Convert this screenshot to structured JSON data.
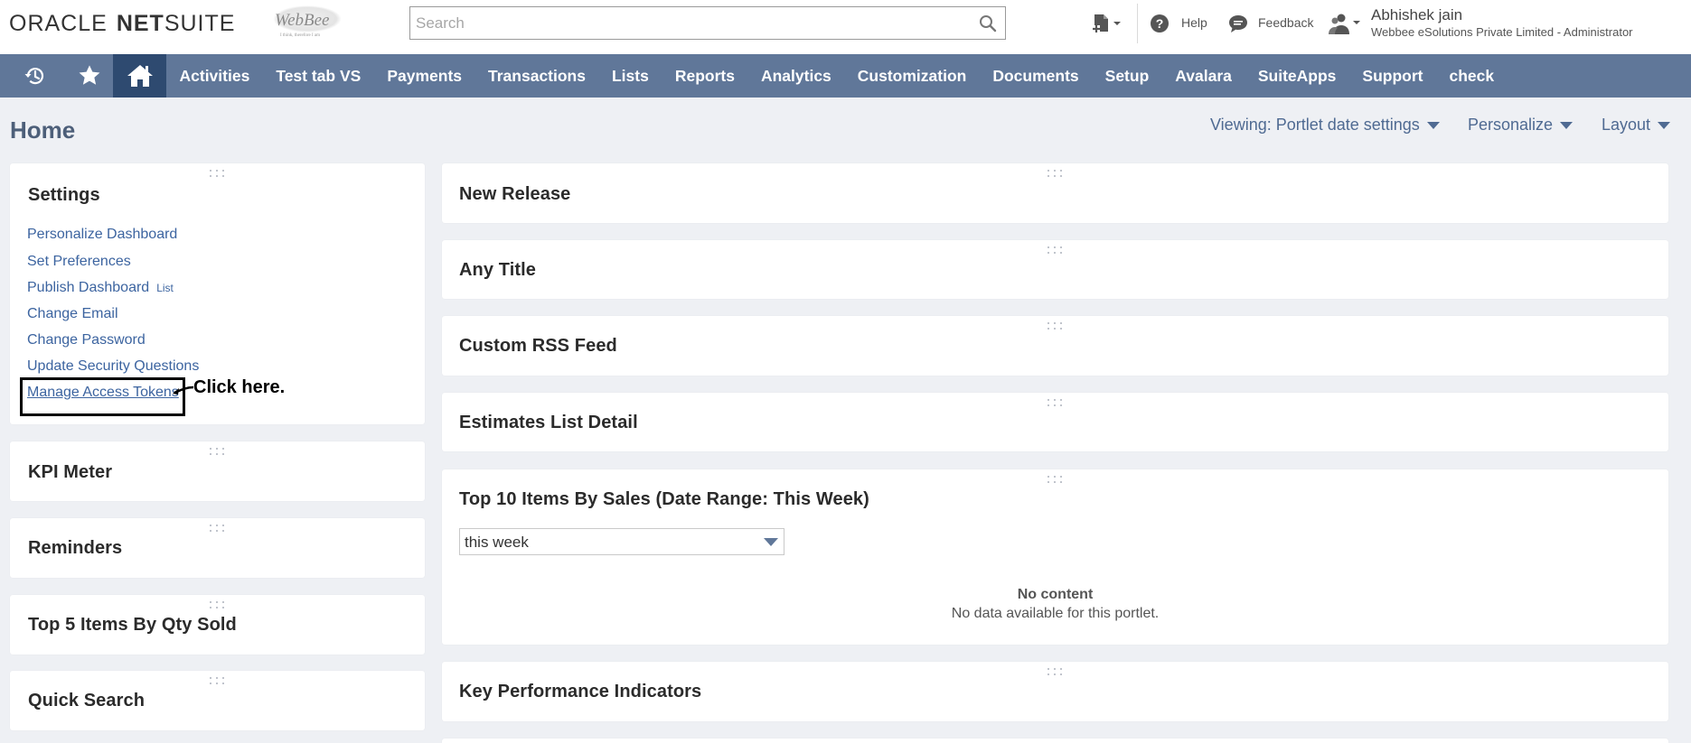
{
  "header": {
    "logo_oracle": "ORACLE",
    "logo_net": "NET",
    "logo_suite": "SUITE",
    "company_logo_text": "WebBee",
    "company_logo_tagline": "I think, therefore I am",
    "search_placeholder": "Search",
    "help_label": "Help",
    "feedback_label": "Feedback",
    "user_name": "Abhishek jain",
    "user_role": "Webbee eSolutions Private Limited - Administrator"
  },
  "nav": {
    "items": [
      "Activities",
      "Test tab VS",
      "Payments",
      "Transactions",
      "Lists",
      "Reports",
      "Analytics",
      "Customization",
      "Documents",
      "Setup",
      "Avalara",
      "SuiteApps",
      "Support",
      "check"
    ]
  },
  "page": {
    "title": "Home",
    "viewing": "Viewing: Portlet date settings",
    "personalize": "Personalize",
    "layout": "Layout"
  },
  "settings_portlet": {
    "title": "Settings",
    "links": [
      "Personalize Dashboard",
      "Set Preferences",
      "Publish Dashboard",
      "Change Email",
      "Change Password",
      "Update Security Questions",
      "Manage Access Tokens"
    ],
    "publish_sub": "List",
    "annotation": "Click here."
  },
  "left_portlets": [
    "KPI Meter",
    "Reminders",
    "Top 5 Items By Qty Sold",
    "Quick Search"
  ],
  "right_portlets": {
    "new_release": "New Release",
    "any_title": "Any Title",
    "rss": "Custom RSS Feed",
    "estimates": "Estimates List Detail",
    "top10": "Top 10 Items By Sales (Date Range: This Week)",
    "top10_select": "this week",
    "no_content_title": "No content",
    "no_content_desc": "No data available for this portlet.",
    "kpi": "Key Performance Indicators"
  },
  "colors": {
    "nav_bg": "#607799",
    "nav_active": "#2e4a70",
    "link": "#3c64a0",
    "page_bg": "#eef0f4"
  }
}
